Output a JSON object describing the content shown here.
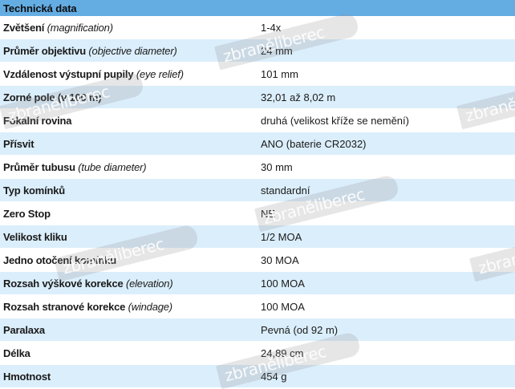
{
  "header": {
    "title": "Technická data"
  },
  "rows": [
    {
      "label": "Zvětšení",
      "note": "(magnification)",
      "value": "1-4x"
    },
    {
      "label": "Průměr objektivu",
      "note": "(objective diameter)",
      "value": "24 mm"
    },
    {
      "label": "Vzdálenost výstupní pupily",
      "note": "(eye relief)",
      "value": "101 mm"
    },
    {
      "label": "Zorné pole (v 100 m)",
      "note": "",
      "value": "32,01 až 8,02 m"
    },
    {
      "label": "Fokální rovina",
      "note": "",
      "value": "druhá (velikost kříže se nemění)"
    },
    {
      "label": "Přísvit",
      "note": "",
      "value": "ANO (baterie CR2032)"
    },
    {
      "label": "Průměr tubusu",
      "note": "(tube diameter)",
      "value": "30 mm"
    },
    {
      "label": "Typ komínků",
      "note": "",
      "value": "standardní"
    },
    {
      "label": "Zero Stop",
      "note": "",
      "value": "NE"
    },
    {
      "label": "Velikost kliku",
      "note": "",
      "value": "1/2 MOA"
    },
    {
      "label": "Jedno otočení komínku",
      "note": "",
      "value": "30 MOA"
    },
    {
      "label": "Rozsah výškové korekce",
      "note": "(elevation)",
      "value": "100 MOA"
    },
    {
      "label": "Rozsah stranové korekce",
      "note": "(windage)",
      "value": "100 MOA"
    },
    {
      "label": "Paralaxa",
      "note": "",
      "value": "Pevná (od 92 m)"
    },
    {
      "label": "Délka",
      "note": "",
      "value": "24,89 cm"
    },
    {
      "label": "Hmotnost",
      "note": "",
      "value": "454 g"
    }
  ],
  "watermark": {
    "prefix": "zbraně",
    "suffix": "liberec"
  },
  "colors": {
    "header": "#64ade3",
    "stripe": "#dbeefb"
  }
}
